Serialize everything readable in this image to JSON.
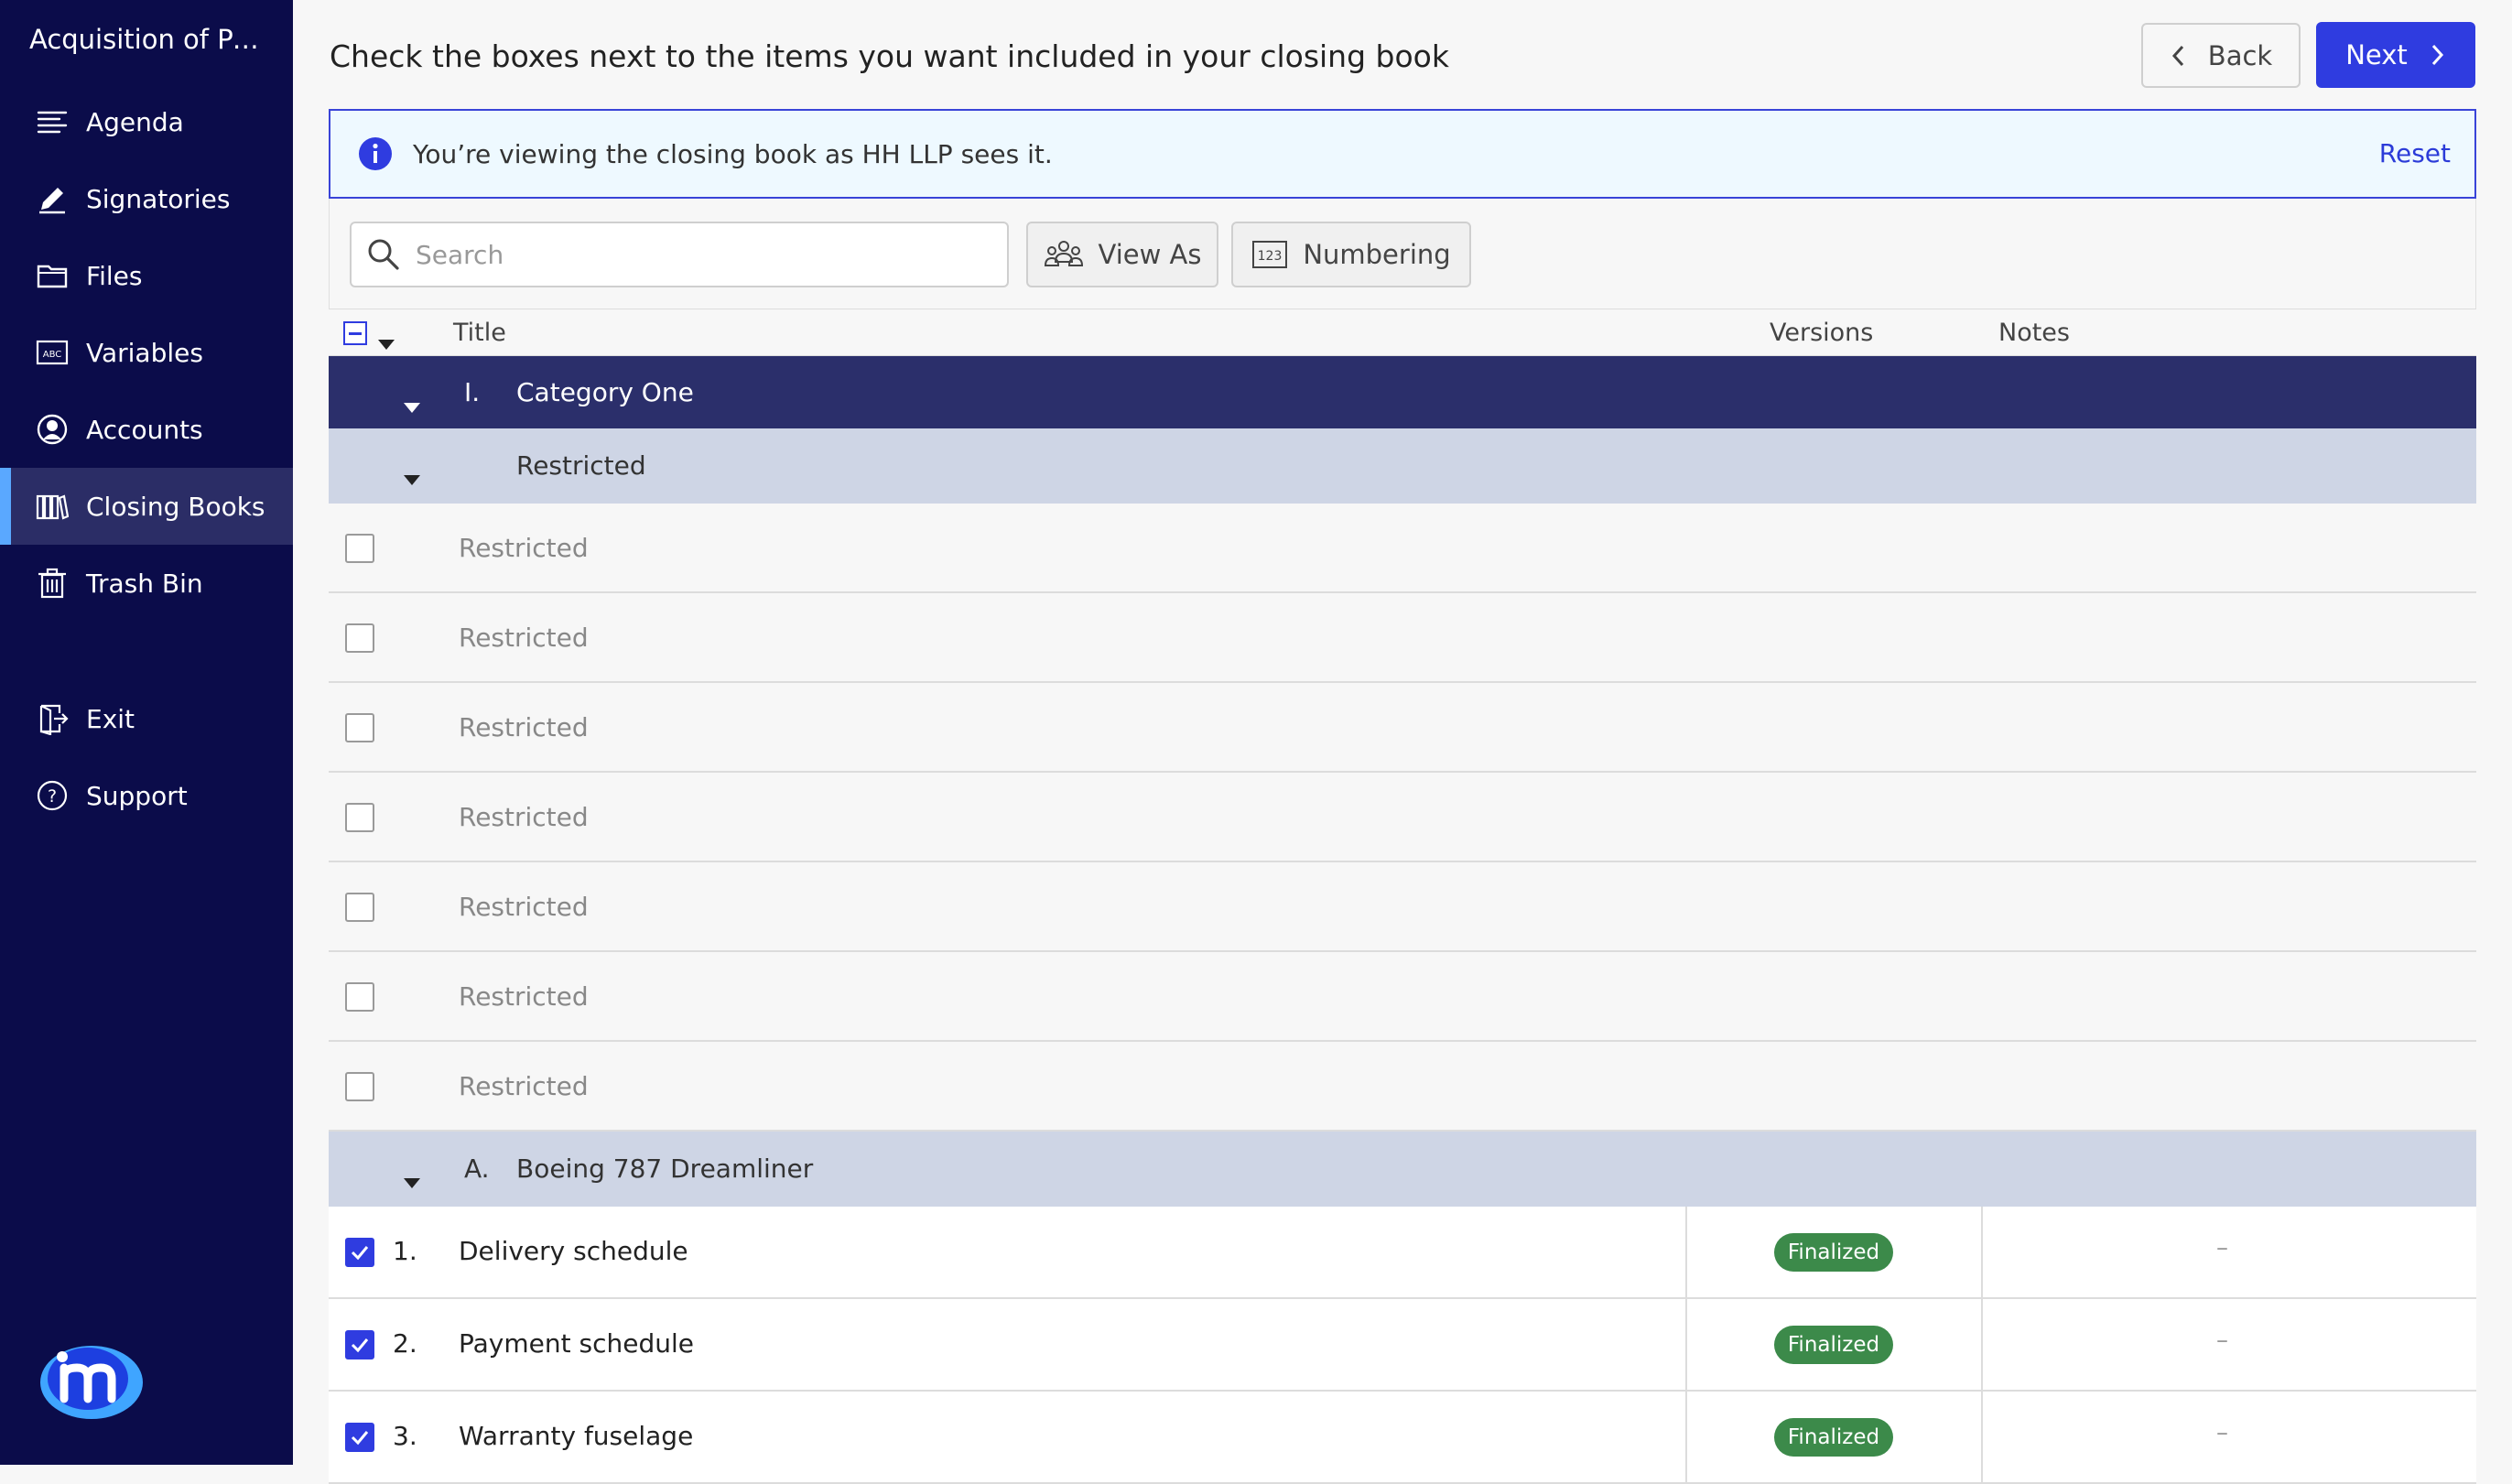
{
  "app": {
    "title": "Acquisition of Pen..."
  },
  "sidebar": {
    "items": [
      {
        "label": "Agenda",
        "icon": "agenda-icon"
      },
      {
        "label": "Signatories",
        "icon": "pen-icon"
      },
      {
        "label": "Files",
        "icon": "folder-icon"
      },
      {
        "label": "Variables",
        "icon": "abc-icon"
      },
      {
        "label": "Accounts",
        "icon": "user-circle-icon"
      },
      {
        "label": "Closing Books",
        "icon": "books-icon",
        "active": true
      },
      {
        "label": "Trash Bin",
        "icon": "trash-icon"
      }
    ],
    "bottom": [
      {
        "label": "Exit",
        "icon": "exit-icon"
      },
      {
        "label": "Support",
        "icon": "question-icon"
      }
    ],
    "logo": "m-logo"
  },
  "header": {
    "title": "Check the boxes next to the items you want included in your closing book",
    "back_label": "Back",
    "next_label": "Next"
  },
  "banner": {
    "text": "You’re viewing the closing book as HH LLP sees it.",
    "reset_label": "Reset"
  },
  "toolbar": {
    "search_placeholder": "Search",
    "view_as_label": "View As",
    "numbering_label": "Numbering"
  },
  "table": {
    "columns": {
      "title": "Title",
      "versions": "Versions",
      "notes": "Notes"
    },
    "category": {
      "number": "I.",
      "name": "Category One"
    },
    "restricted_group": {
      "name": "Restricted"
    },
    "restricted_rows": [
      "Restricted",
      "Restricted",
      "Restricted",
      "Restricted",
      "Restricted",
      "Restricted",
      "Restricted"
    ],
    "subgroup": {
      "number": "A.",
      "name": "Boeing 787 Dreamliner"
    },
    "items": [
      {
        "number": "1.",
        "title": "Delivery schedule",
        "status": "Finalized",
        "notes": "–",
        "checked": true
      },
      {
        "number": "2.",
        "title": "Payment schedule",
        "status": "Finalized",
        "notes": "–",
        "checked": true
      },
      {
        "number": "3.",
        "title": "Warranty fuselage",
        "status": "Finalized",
        "notes": "–",
        "checked": true
      }
    ]
  },
  "colors": {
    "sidebar_bg": "#0b0c4a",
    "accent": "#2f3ce0",
    "category_bg": "#2b2f6b",
    "finalized": "#3c8a4a"
  }
}
